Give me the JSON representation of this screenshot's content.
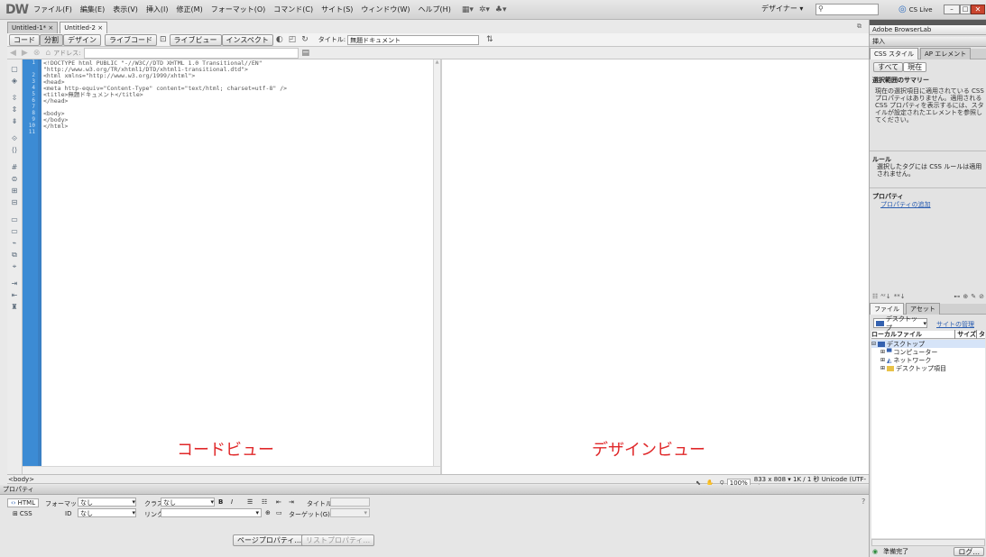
{
  "app": {
    "logo": "DW",
    "cs_live": "CS Live",
    "workspace": "デザイナー ▾"
  },
  "menu": [
    "ファイル(F)",
    "編集(E)",
    "表示(V)",
    "挿入(I)",
    "修正(M)",
    "フォーマット(O)",
    "コマンド(C)",
    "サイト(S)",
    "ウィンドウ(W)",
    "ヘルプ(H)"
  ],
  "doc_tabs": [
    {
      "label": "Untitled-1*"
    },
    {
      "label": "Untitled-2"
    }
  ],
  "toolbar": {
    "code": "コード",
    "split": "分割",
    "design": "デザイン",
    "livecode": "ライブコード",
    "liveview": "ライブビュー",
    "inspect": "インスペクト",
    "title_label": "タイトル:",
    "title_value": "無題ドキュメント"
  },
  "address": {
    "label": "アドレス:"
  },
  "code": {
    "lines": [
      "<!DOCTYPE html PUBLIC \"-//W3C//DTD XHTML 1.0 Transitional//EN\"",
      "\"http://www.w3.org/TR/xhtml1/DTD/xhtml1-transitional.dtd\">",
      "<html xmlns=\"http://www.w3.org/1999/xhtml\">",
      "<head>",
      "<meta http-equiv=\"Content-Type\" content=\"text/html; charset=utf-8\" />",
      "<title>無題ドキュメント</title>",
      "</head>",
      "",
      "<body>",
      "</body>",
      "</html>"
    ],
    "gutter": "1\n \n2\n3\n4\n5\n6\n7\n8\n9\n10\n11"
  },
  "overlay": {
    "code_view": "コードビュー",
    "design_view": "デザインビュー",
    "color": "#e0282a"
  },
  "statusbar": {
    "tag": "<body>",
    "zoom": "100%",
    "info": "833 x 808 ▾  1K / 1 秒  Unicode (UTF-8)"
  },
  "props": {
    "title": "プロパティ",
    "html": "HTML",
    "css": "CSS",
    "format_label": "フォーマット",
    "format_value": "なし",
    "class_label": "クラス",
    "class_value": "なし",
    "id_label": "ID",
    "id_value": "なし",
    "link_label": "リンク",
    "title2_label": "タイトル",
    "target_label": "ターゲット(G)",
    "page_props": "ページプロパティ...",
    "list_props": "リストプロパティ..."
  },
  "right": {
    "browserlab": "Adobe BrowserLab",
    "insert": "挿入",
    "css_tab": "CSS スタイル",
    "ap_tab": "AP エレメント",
    "all": "すべて",
    "current": "現在",
    "summary_title": "選択範囲のサマリー",
    "summary_text": "現在の選択項目に適用されている CSS プロパティはありません。適用される CSS プロパティを表示するには、スタイルが設定されたエレメントを参照してください。",
    "rules_title": "ルール",
    "rules_text": "選択したタグには CSS ルールは適用されません。",
    "props_title": "プロパティ",
    "add_prop": "プロパティの追加",
    "files_tab": "ファイル",
    "assets_tab": "アセット",
    "location": "デスクトップ",
    "manage": "サイトの管理",
    "col_local": "ローカルファイル",
    "col_size": "サイズ",
    "col_type": "タ",
    "tree": [
      "デスクトップ",
      "コンピューター",
      "ネットワーク",
      "デスクトップ項目"
    ],
    "ready": "準備完了",
    "log": "ログ..."
  }
}
